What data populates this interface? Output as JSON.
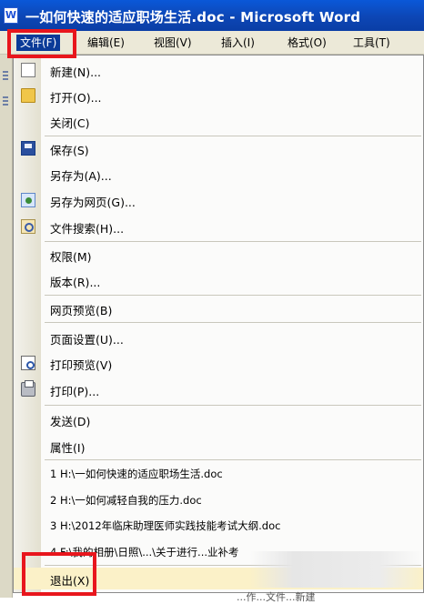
{
  "window": {
    "title": "一如何快速的适应职场生活.doc - Microsoft Word"
  },
  "menubar": {
    "items": [
      "文件(F)",
      "编辑(E)",
      "视图(V)",
      "插入(I)",
      "格式(O)",
      "工具(T)"
    ]
  },
  "file_menu": {
    "new": "新建(N)...",
    "open": "打开(O)...",
    "close": "关闭(C)",
    "save": "保存(S)",
    "save_as": "另存为(A)...",
    "save_as_web": "另存为网页(G)...",
    "file_search": "文件搜索(H)...",
    "permission": "权限(M)",
    "versions": "版本(R)...",
    "web_preview": "网页预览(B)",
    "page_setup": "页面设置(U)...",
    "print_preview": "打印预览(V)",
    "print": "打印(P)...",
    "send_to": "发送(D)",
    "properties": "属性(I)",
    "recent": [
      "1 H:\\一如何快速的适应职场生活.doc",
      "2 H:\\一如何减轻自我的压力.doc",
      "3 H:\\2012年临床助理医师实践技能考试大纲.doc",
      "4 F:\\我的相册\\日照\\...\\关于进行...业补考"
    ],
    "exit": "退出(X)"
  },
  "bottom_text": "...作...文件...新建"
}
